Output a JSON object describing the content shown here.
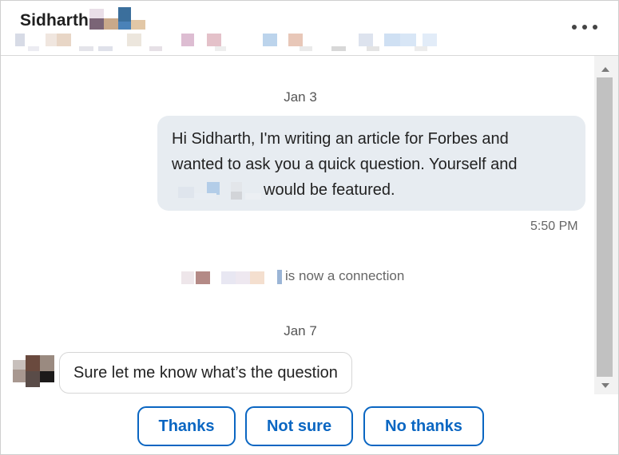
{
  "header": {
    "contact_name": "Sidharth",
    "more_icon": "more-horizontal-icon"
  },
  "thread": {
    "date_1": "Jan 3",
    "sent_message": {
      "line1": "Hi Sidharth, I'm writing an article for Forbes and",
      "line2": "wanted to ask you a quick question. Yourself and",
      "line3": "would be featured.",
      "time": "5:50 PM"
    },
    "connection_notice": "is now a connection",
    "date_2": "Jan 7",
    "received_message": "Sure let me know what’s the question"
  },
  "quick_replies": [
    {
      "label": "Thanks"
    },
    {
      "label": "Not sure"
    },
    {
      "label": "No thanks"
    }
  ],
  "colors": {
    "accent": "#0a66c2",
    "sent_bubble_bg": "#e7ecf1",
    "scroll_thumb": "#c1c1c1"
  }
}
